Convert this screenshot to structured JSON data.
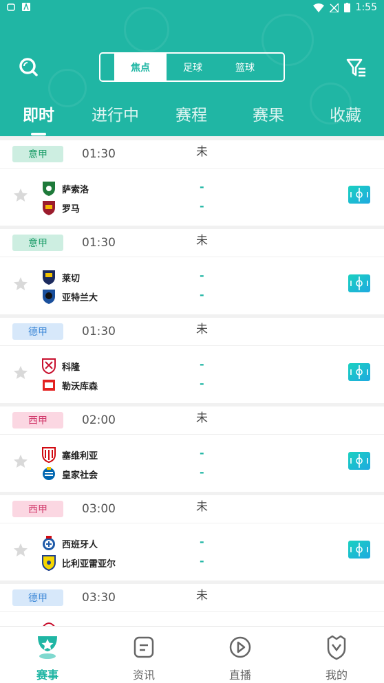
{
  "status_bar": {
    "time": "1:55"
  },
  "segment": {
    "items": [
      "焦点",
      "足球",
      "篮球"
    ],
    "active": 0
  },
  "tabs": [
    "即时",
    "进行中",
    "赛程",
    "赛果",
    "收藏"
  ],
  "matches": [
    {
      "league": "意甲",
      "league_bg": "#cdeee1",
      "league_color": "#1e9e6a",
      "time": "01:30",
      "status": "未",
      "home": "萨索洛",
      "away": "罗马",
      "home_score": "-",
      "away_score": "-"
    },
    {
      "league": "意甲",
      "league_bg": "#cdeee1",
      "league_color": "#1e9e6a",
      "time": "01:30",
      "status": "未",
      "home": "莱切",
      "away": "亚特兰大",
      "home_score": "-",
      "away_score": "-"
    },
    {
      "league": "德甲",
      "league_bg": "#d7e8fa",
      "league_color": "#3a86d6",
      "time": "01:30",
      "status": "未",
      "home": "科隆",
      "away": "勒沃库森",
      "home_score": "-",
      "away_score": "-"
    },
    {
      "league": "西甲",
      "league_bg": "#fbd7e2",
      "league_color": "#d13a6c",
      "time": "02:00",
      "status": "未",
      "home": "塞维利亚",
      "away": "皇家社会",
      "home_score": "-",
      "away_score": "-"
    },
    {
      "league": "西甲",
      "league_bg": "#fbd7e2",
      "league_color": "#d13a6c",
      "time": "03:00",
      "status": "未",
      "home": "西班牙人",
      "away": "比利亚雷亚尔",
      "home_score": "-",
      "away_score": "-"
    },
    {
      "league": "德甲",
      "league_bg": "#d7e8fa",
      "league_color": "#3a86d6",
      "time": "03:30",
      "status": "未",
      "home": "",
      "away": "",
      "home_score": "",
      "away_score": ""
    }
  ],
  "bottom_nav": [
    {
      "label": "赛事",
      "icon": "trophy-icon",
      "active": true
    },
    {
      "label": "资讯",
      "icon": "news-icon",
      "active": false
    },
    {
      "label": "直播",
      "icon": "play-icon",
      "active": false
    },
    {
      "label": "我的",
      "icon": "profile-icon",
      "active": false
    }
  ],
  "colors": {
    "primary": "#20b6a4",
    "background": "#f1f1f1"
  }
}
